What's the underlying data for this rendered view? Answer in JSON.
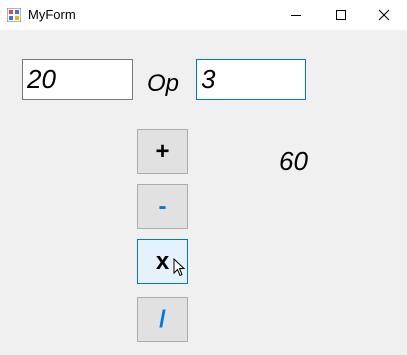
{
  "window": {
    "title": "MyForm"
  },
  "inputs": {
    "first": "20",
    "second": "3"
  },
  "op_label": "Op",
  "result": "60",
  "buttons": {
    "add": "+",
    "subtract": "-",
    "multiply": "x",
    "divide": "/"
  }
}
